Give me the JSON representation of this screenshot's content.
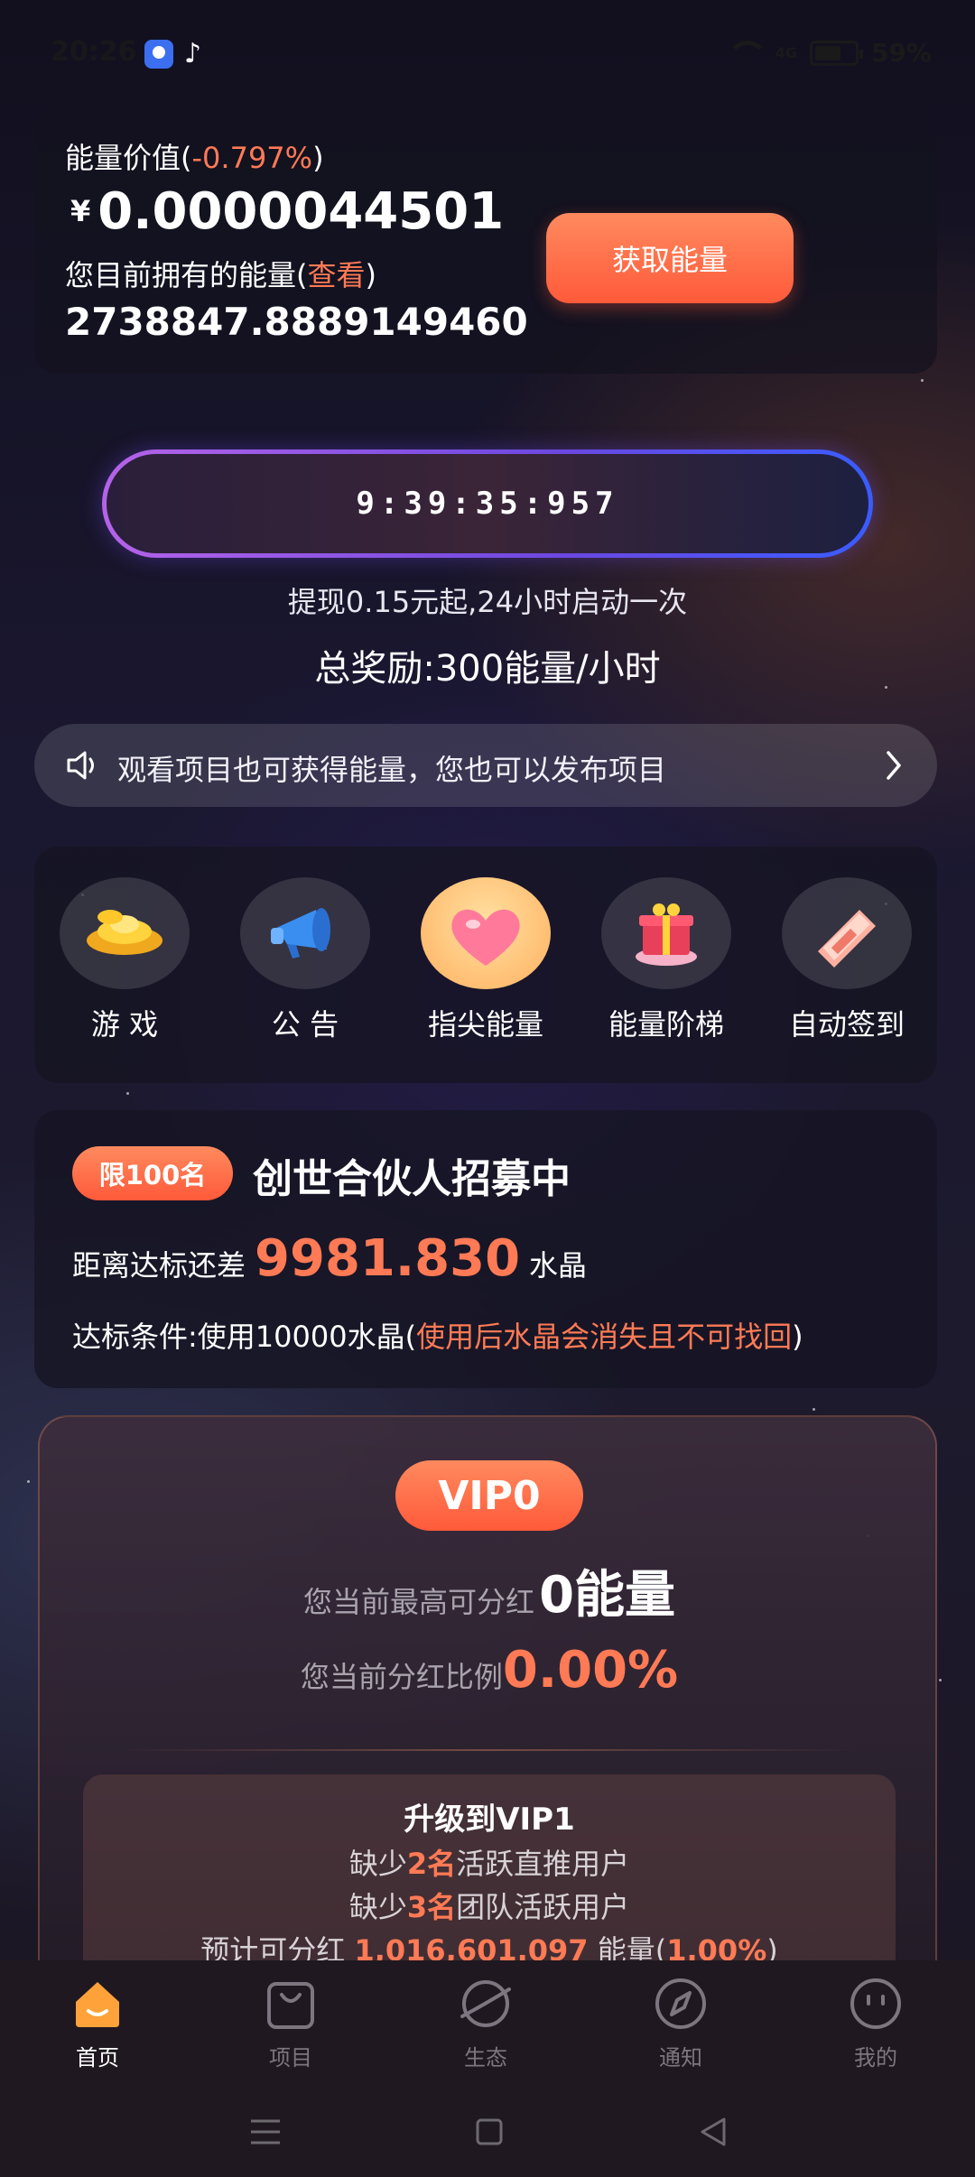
{
  "status_bar": {
    "time": "20:26",
    "signal": "4G",
    "battery": "59%"
  },
  "energy": {
    "value_label": "能量价值(",
    "change": "-0.797%",
    "value_label_end": ")",
    "currency": "¥",
    "price": "0.0000044501",
    "owned_label": "您目前拥有的能量(",
    "view_link": "查看",
    "owned_label_end": ")",
    "amount": "2738847.8889149460",
    "get_button": "获取能量"
  },
  "timer": {
    "value": "9:39:35:957",
    "subtitle": "提现0.15元起,24小时启动一次",
    "reward": "总奖励:300能量/小时"
  },
  "notice": {
    "text": "观看项目也可获得能量，您也可以发布项目"
  },
  "features": [
    {
      "label": "游 戏",
      "icon": "gold-ingot-icon"
    },
    {
      "label": "公 告",
      "icon": "megaphone-icon"
    },
    {
      "label": "指尖能量",
      "icon": "heart-icon"
    },
    {
      "label": "能量阶梯",
      "icon": "gift-box-icon"
    },
    {
      "label": "自动签到",
      "icon": "money-icon"
    }
  ],
  "partner": {
    "badge": "限100名",
    "title": "创世合伙人招募中",
    "gap_label": "距离达标还差",
    "gap_value": "9981.830",
    "gap_unit": "水晶",
    "condition_label": "达标条件:使用10000水晶(",
    "condition_warning": "使用后水晶会消失且不可找回",
    "condition_end": ")"
  },
  "vip": {
    "level": "VIP0",
    "max_dividend_label": "您当前最高可分红",
    "max_dividend_value": "0能量",
    "ratio_label": "您当前分红比例",
    "ratio_value": "0.00%",
    "upgrade_title": "升级到VIP1",
    "req1_pre": "缺少",
    "req1_num": "2名",
    "req1_post": "活跃直推用户",
    "req2_pre": "缺少",
    "req2_num": "3名",
    "req2_post": "团队活跃用户",
    "est_pre": "预计可分红",
    "est_value": "1,016,601.097",
    "est_mid": "能量(",
    "est_pct": "1.00%",
    "est_end": ")"
  },
  "nav": [
    {
      "label": "首页",
      "icon": "home-icon",
      "active": true
    },
    {
      "label": "项目",
      "icon": "bag-icon",
      "active": false
    },
    {
      "label": "生态",
      "icon": "planet-icon",
      "active": false
    },
    {
      "label": "通知",
      "icon": "compass-icon",
      "active": false
    },
    {
      "label": "我的",
      "icon": "smile-icon",
      "active": false
    }
  ],
  "colors": {
    "accent": "#ff6a45",
    "accent_text": "#ff7a55",
    "timer_border_start": "#b463e8",
    "timer_border_end": "#3a5cff"
  }
}
